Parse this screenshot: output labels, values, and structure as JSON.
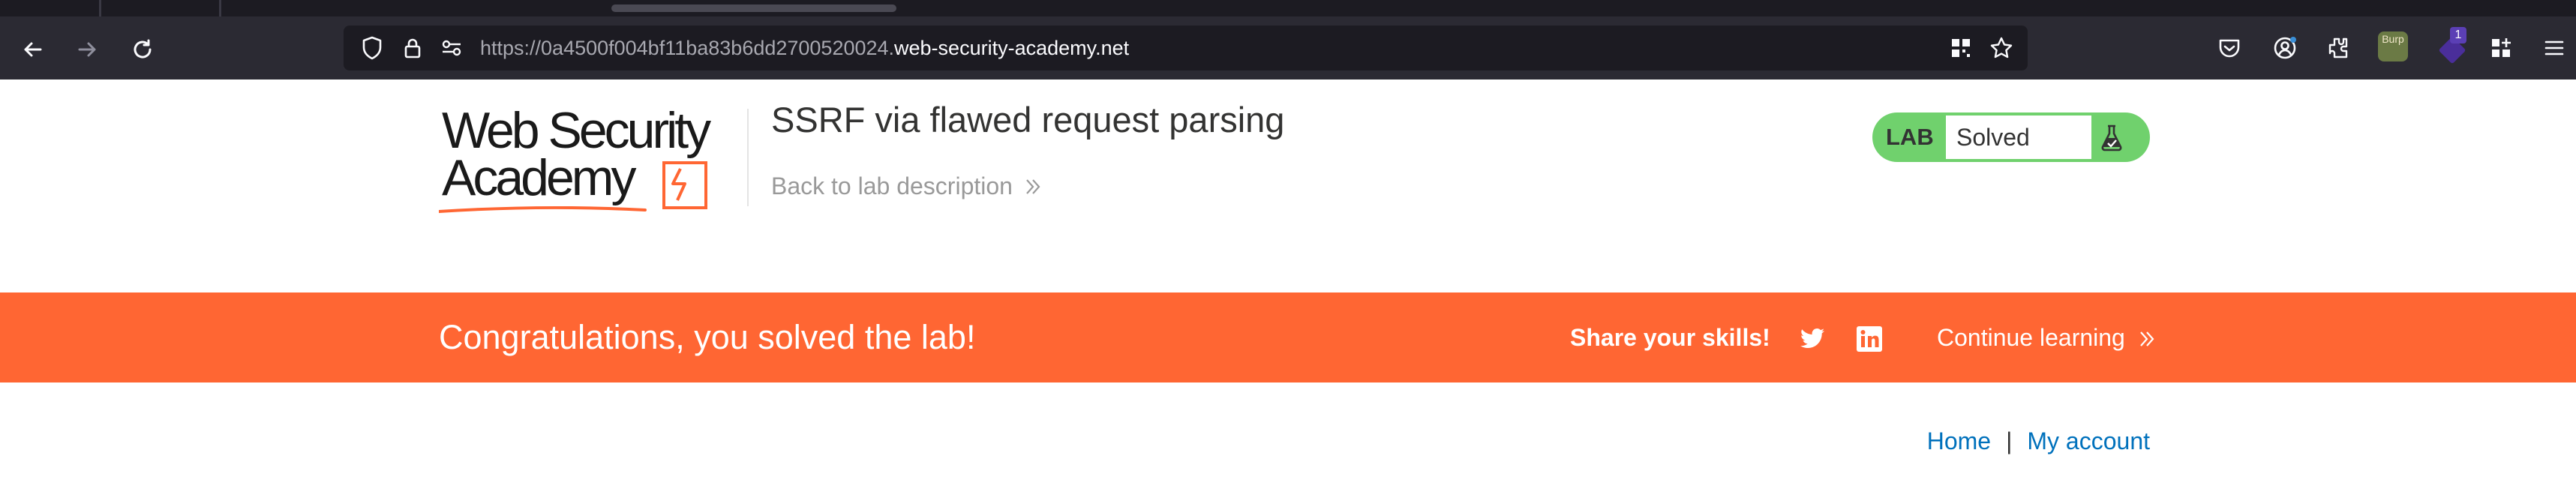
{
  "browser": {
    "url_prefix": "https://0a4500f004bf11ba83b6dd2700520024.",
    "url_host": "web-security-academy.net",
    "extensions": {
      "burp_label": "Burp",
      "badge_count": "1"
    }
  },
  "header": {
    "logo_line1": "Web Security",
    "logo_line2": "Academy",
    "lab_title": "SSRF via flawed request parsing",
    "back_link": "Back to lab description",
    "lab_badge_label": "LAB",
    "lab_status": "Solved"
  },
  "banner": {
    "message": "Congratulations, you solved the lab!",
    "share_label": "Share your skills!",
    "continue_label": "Continue learning"
  },
  "nav": {
    "home": "Home",
    "separator": "|",
    "my_account": "My account"
  },
  "colors": {
    "accent_orange": "#ff6633",
    "solved_green": "#70d16d",
    "link_blue": "#0071bc"
  },
  "icons": [
    "back-arrow-icon",
    "forward-arrow-icon",
    "reload-icon",
    "shield-icon",
    "lock-icon",
    "permissions-icon",
    "qr-code-icon",
    "star-icon",
    "pocket-icon",
    "account-icon",
    "extensions-icon",
    "apps-icon",
    "menu-icon",
    "flask-icon",
    "twitter-icon",
    "linkedin-icon"
  ]
}
